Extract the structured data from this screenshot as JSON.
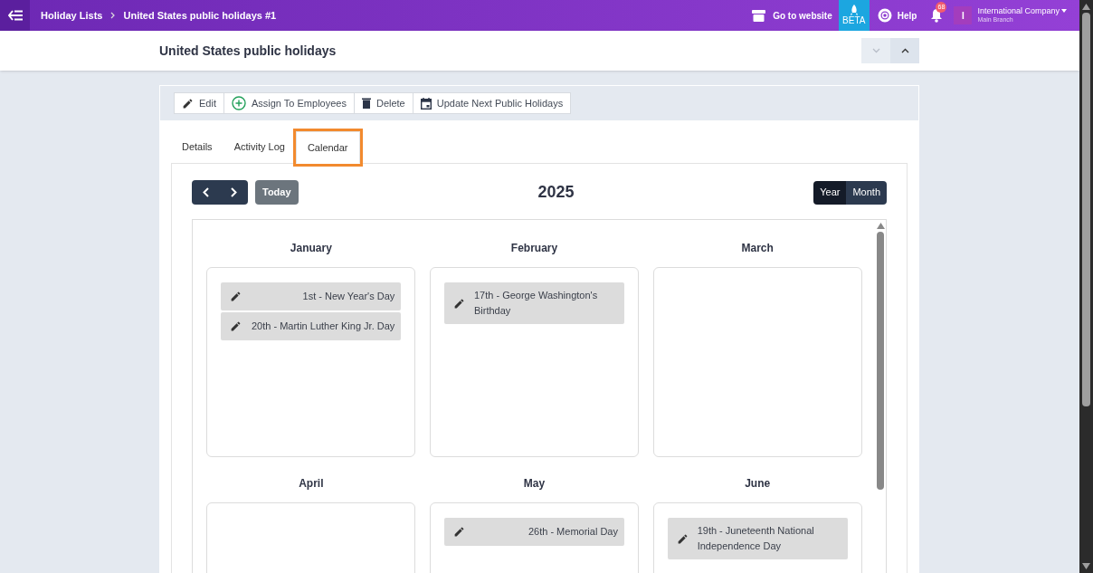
{
  "topbar": {
    "breadcrumbs": [
      "Holiday Lists",
      "United States public holidays #1"
    ],
    "website_link": "Go to website",
    "beta": "BETA",
    "help": "Help",
    "notification_count": "68",
    "avatar": "I",
    "company": "International Company",
    "branch": "Main Branch"
  },
  "page_title": "United States public holidays",
  "toolbar": [
    {
      "kind": "edit",
      "label": "Edit"
    },
    {
      "kind": "assign",
      "label": "Assign To Employees"
    },
    {
      "kind": "delete",
      "label": "Delete"
    },
    {
      "kind": "calendar",
      "label": "Update Next Public Holidays"
    }
  ],
  "tabs": [
    {
      "label": "Details",
      "selected": false,
      "highlighted": false
    },
    {
      "label": "Activity Log",
      "selected": false,
      "highlighted": false
    },
    {
      "label": "Calendar",
      "selected": true,
      "highlighted": true
    }
  ],
  "calendar": {
    "today": "Today",
    "year": "2025",
    "views": [
      {
        "label": "Year",
        "selected": true
      },
      {
        "label": "Month",
        "selected": false
      }
    ],
    "months": [
      {
        "name": "January",
        "holidays": [
          "1st - New Year's Day",
          "20th - Martin Luther King Jr. Day"
        ]
      },
      {
        "name": "February",
        "holidays": [
          "17th - George Washington's Birthday"
        ]
      },
      {
        "name": "March"
      },
      {
        "name": "April"
      },
      {
        "name": "May",
        "holidays": [
          "26th - Memorial Day"
        ]
      },
      {
        "name": "June",
        "holidays": [
          "19th - Juneteenth National Independence Day"
        ]
      }
    ]
  }
}
